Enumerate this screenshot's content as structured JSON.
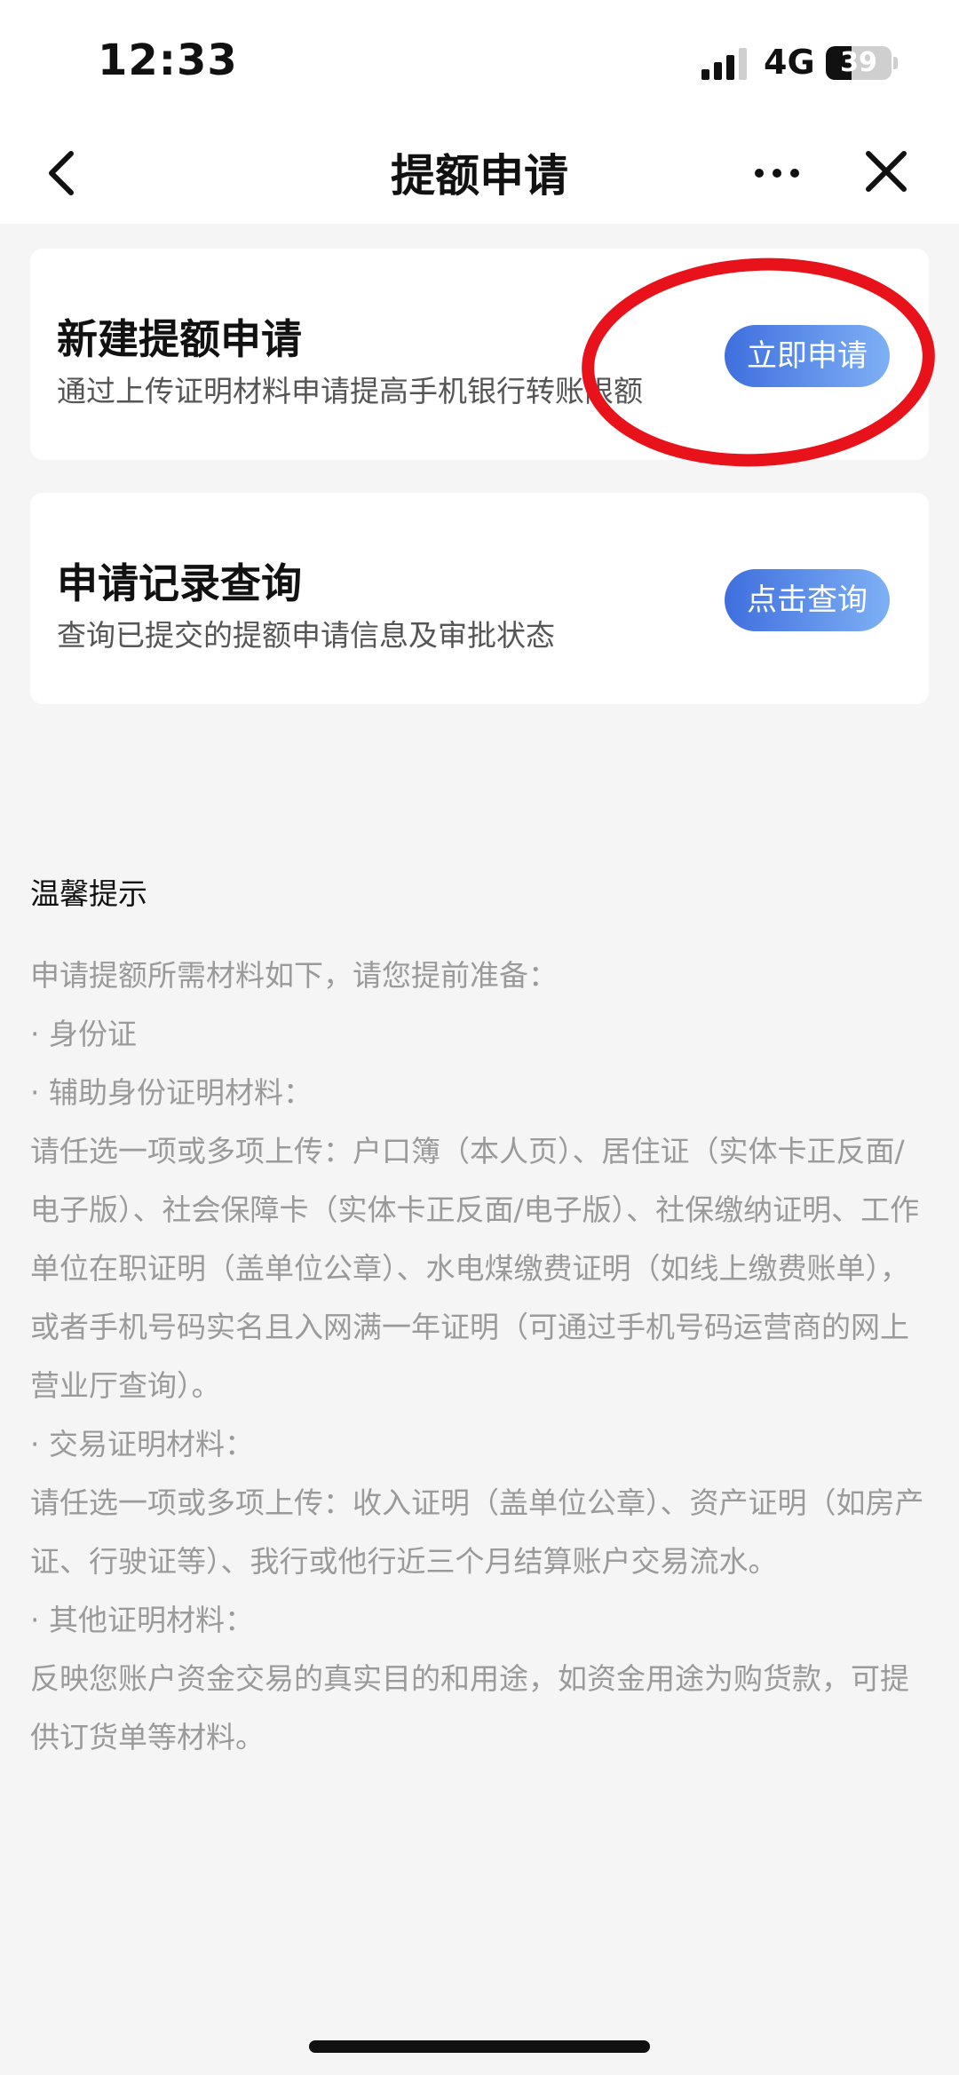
{
  "status_bar": {
    "time": "12:33",
    "network": "4G",
    "battery_level": "39"
  },
  "nav": {
    "title": "提额申请"
  },
  "cards": [
    {
      "title": "新建提额申请",
      "description": "通过上传证明材料申请提高手机银行转账限额",
      "button_label": "立即申请"
    },
    {
      "title": "申请记录查询",
      "description": "查询已提交的提额申请信息及审批状态",
      "button_label": "点击查询"
    }
  ],
  "tips": {
    "title": "温馨提示",
    "lines": [
      "申请提额所需材料如下，请您提前准备：",
      "· 身份证",
      "· 辅助身份证明材料：",
      "请任选一项或多项上传：户口簿（本人页）、居住证（实体卡正反面/电子版）、社会保障卡（实体卡正反面/电子版）、社保缴纳证明、工作单位在职证明（盖单位公章）、水电煤缴费证明（如线上缴费账单），或者手机号码实名且入网满一年证明（可通过手机号码运营商的网上营业厅查询）。",
      "· 交易证明材料：",
      "请任选一项或多项上传：收入证明（盖单位公章）、资产证明（如房产证、行驶证等）、我行或他行近三个月结算账户交易流水。",
      "· 其他证明材料：",
      "反映您账户资金交易的真实目的和用途，如资金用途为购货款，可提供订货单等材料。"
    ]
  },
  "icons": {
    "back": "chevron-left-icon",
    "more": "more-icon",
    "close": "close-icon",
    "signal": "signal-icon",
    "battery": "battery-icon"
  },
  "colors": {
    "button_start": "#3f6fde",
    "button_end": "#7eb0f5",
    "highlight": "#e8121a"
  }
}
